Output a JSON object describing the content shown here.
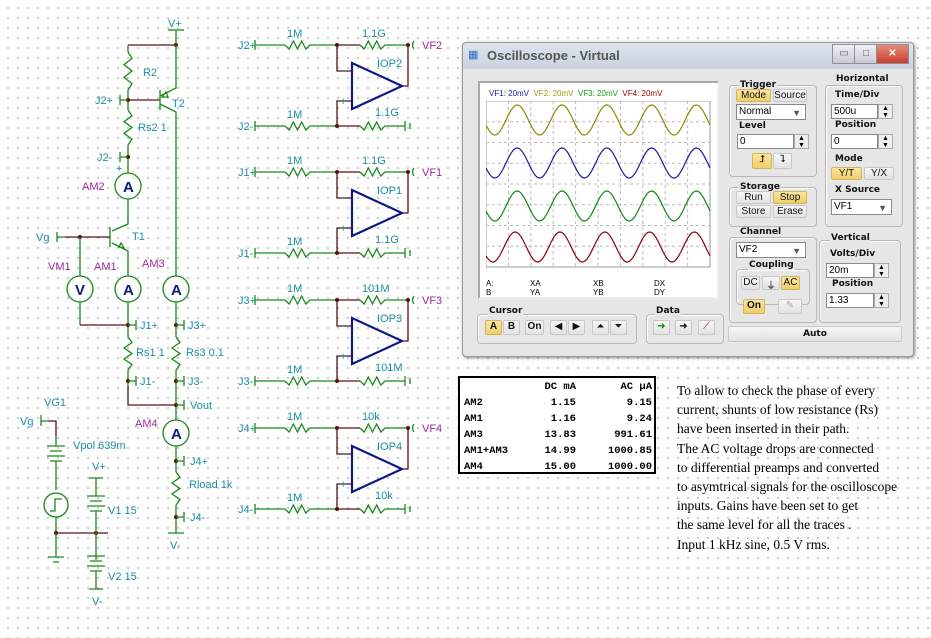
{
  "schematic": {
    "labels": {
      "vplus_top": "V+",
      "r2": "R2",
      "t2": "T2",
      "j2p": "J2+",
      "rs2": "Rs2 1",
      "j2m": "J2-",
      "am2": "AM2",
      "vg": "Vg",
      "t1": "T1",
      "vm1": "VM1",
      "am1": "AM1",
      "am3": "AM3",
      "j1p": "J1+",
      "j3p": "J3+",
      "rs1": "Rs1 1",
      "rs3": "Rs3 0.1",
      "j1m": "J1-",
      "j3m": "J3-",
      "vout": "Vout",
      "am4": "AM4",
      "j4p": "J4+",
      "rload": "Rload 1k",
      "j4m": "J4-",
      "vminus_load": "V-",
      "vg1": "VG1",
      "vg_src": "Vg",
      "vpol": "Vpol 639m",
      "vplus_supply": "V+",
      "v1": "V1 15",
      "v2": "V2 15",
      "vminus_supply": "V-"
    },
    "meters": {
      "ammeter_symbol": "A",
      "voltmeter_symbol": "V"
    },
    "preamps": [
      {
        "name": "IOP2",
        "in_p": "J2+",
        "in_m": "J2-",
        "r_in": "1M",
        "r_fb": "1.1G",
        "output": "VF2"
      },
      {
        "name": "IOP1",
        "in_p": "J1+",
        "in_m": "J1-",
        "r_in": "1M",
        "r_fb": "1.1G",
        "output": "VF1"
      },
      {
        "name": "IOP3",
        "in_p": "J3+",
        "in_m": "J3-",
        "r_in": "1M",
        "r_fb": "101M",
        "output": "VF3"
      },
      {
        "name": "IOP4",
        "in_p": "J4+",
        "in_m": "J4-",
        "r_in": "1M",
        "r_fb": "10k",
        "output": "VF4"
      }
    ]
  },
  "oscilloscope": {
    "title": "Oscilloscope - Virtual",
    "window_buttons": [
      "minimize",
      "maximize",
      "close"
    ],
    "legend": [
      {
        "label": "VF1: 20mV",
        "color": "#1a1aa0"
      },
      {
        "label": "VF2: 20mV",
        "color": "#a0a000"
      },
      {
        "label": "VF3: 20mV",
        "color": "#10a010"
      },
      {
        "label": "VF4: 20mV",
        "color": "#a00000"
      }
    ],
    "traces": [
      {
        "channel": "VF2",
        "color": "#8a8a00",
        "frequency_hz": 1000
      },
      {
        "channel": "VF1",
        "color": "#1a1aa0",
        "frequency_hz": 1000
      },
      {
        "channel": "VF3",
        "color": "#108a10",
        "frequency_hz": 1000
      },
      {
        "channel": "VF4",
        "color": "#8a0010",
        "frequency_hz": 1000
      }
    ],
    "cursor_readout": {
      "a": "A:",
      "b": "B",
      "xa": "XA",
      "ya": "YA",
      "xb": "XB",
      "yb": "YB",
      "dx": "DX",
      "dy": "DY"
    },
    "trigger": {
      "title": "Trigger",
      "mode": "Mode",
      "source": "Source",
      "mode_value": "Normal",
      "level_label": "Level",
      "level_value": "0"
    },
    "horizontal": {
      "title": "Horizontal",
      "time_div_label": "Time/Div",
      "time_div": "500u",
      "position_label": "Position",
      "position": "0",
      "mode_label": "Mode",
      "yt": "Y/T",
      "yx": "Y/X",
      "xsource_label": "X Source",
      "xsource": "VF1"
    },
    "storage": {
      "title": "Storage",
      "run": "Run",
      "stop": "Stop",
      "store": "Store",
      "erase": "Erase"
    },
    "channel": {
      "title": "Channel",
      "value": "VF2",
      "coupling_label": "Coupling",
      "dc": "DC",
      "ac": "AC",
      "on": "On"
    },
    "vertical": {
      "title": "Vertical",
      "volts_div_label": "Volts/Div",
      "volts_div": "20m",
      "position_label": "Position",
      "position": "1.33"
    },
    "cursor": {
      "title": "Cursor",
      "a": "A",
      "b": "B",
      "on": "On"
    },
    "data": {
      "title": "Data"
    },
    "auto": "Auto"
  },
  "table": {
    "headers": [
      "",
      "DC mA",
      "AC µA"
    ],
    "rows": [
      [
        "AM2",
        "1.15",
        "9.15"
      ],
      [
        "AM1",
        "1.16",
        "9.24"
      ],
      [
        "AM3",
        "13.83",
        "991.61"
      ],
      [
        "AM1+AM3",
        "14.99",
        "1000.85"
      ],
      [
        "AM4",
        "15.00",
        "1000.00"
      ]
    ]
  },
  "note": [
    "To allow to check the phase of every",
    "current, shunts of low resistance (Rs)",
    "have been inserted in their path.",
    "The AC voltage drops are connected",
    "to differential preamps and converted",
    "to asymtrical signals for the oscilloscope",
    "inputs. Gains have been set to get",
    "the same level for all the traces .",
    "Input 1 kHz sine, 0.5 V rms."
  ]
}
